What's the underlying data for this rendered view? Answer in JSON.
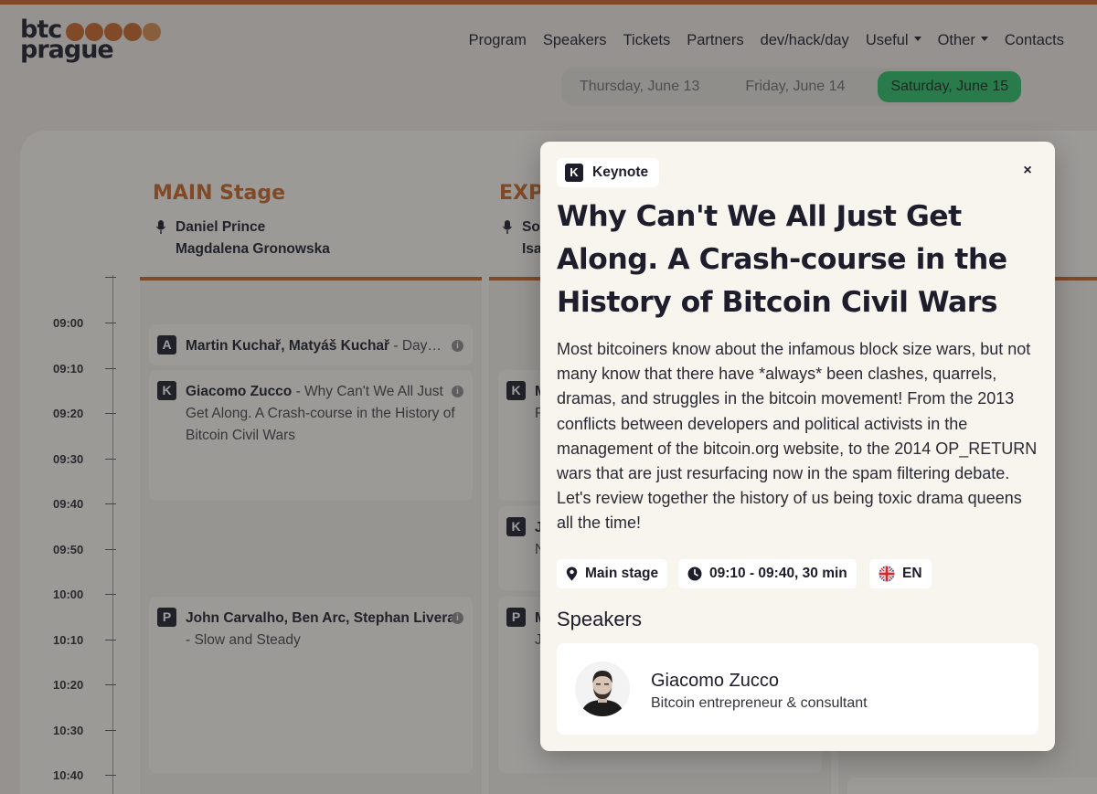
{
  "header": {
    "logo_top": "btc",
    "logo_bottom": "prague",
    "logo_dot_colors": [
      "#c8672a",
      "#c8672a",
      "#c8672a",
      "#c8672a",
      "#d98a4f"
    ],
    "nav": [
      {
        "label": "Program",
        "dropdown": false
      },
      {
        "label": "Speakers",
        "dropdown": false
      },
      {
        "label": "Tickets",
        "dropdown": false
      },
      {
        "label": "Partners",
        "dropdown": false
      },
      {
        "label": "dev/hack/day",
        "dropdown": false
      },
      {
        "label": "Useful",
        "dropdown": true
      },
      {
        "label": "Other",
        "dropdown": true
      },
      {
        "label": "Contacts",
        "dropdown": false
      }
    ]
  },
  "days": [
    {
      "label": "Thursday, June 13",
      "active": false
    },
    {
      "label": "Friday, June 14",
      "active": false
    },
    {
      "label": "Saturday, June 15",
      "active": true
    }
  ],
  "schedule": {
    "stages": [
      {
        "title": "MAIN Stage",
        "mcs": [
          "Daniel Prince",
          "Magdalena Gronowska"
        ]
      },
      {
        "title": "EXPO",
        "mcs": [
          "So",
          "Isa"
        ]
      }
    ],
    "times": [
      "09:00",
      "09:10",
      "09:20",
      "09:30",
      "09:40",
      "09:50",
      "10:00",
      "10:10",
      "10:20",
      "10:30",
      "10:40"
    ],
    "events": [
      {
        "badge": "A",
        "speakers": "Martin Kuchař, Matyáš Kuchař",
        "title": " - Day…"
      },
      {
        "badge": "K",
        "speakers": "Giacomo Zucco",
        "title": " - Why Can't We All Just Get Along. A Crash-course in the History of Bitcoin Civil Wars"
      },
      {
        "badge": "P",
        "speakers": "John Carvalho, Ben Arc, Stephan Livera",
        "title": " - Slow and Steady"
      },
      {
        "badge": "K",
        "speakers": "M",
        "title": "R"
      },
      {
        "badge": "K",
        "speakers": "J",
        "title": "N"
      },
      {
        "badge": "P",
        "speakers": "M",
        "title": "J Y"
      }
    ]
  },
  "modal": {
    "type_badge": "K",
    "type_label": "Keynote",
    "close_glyph": "×",
    "title": "Why Can't We All Just Get Along. A Crash-course in the History of Bitcoin Civil Wars",
    "description": "Most bitcoiners know about the infamous block size wars, but not many know that there have *always* been clashes, quarrels, dramas, and struggles in the bitcoin movement! From the 2013 conflicts between developers and political activists in the management of the bitcoin.org website, to the 2014 OP_RETURN wars that are just resurfacing now in the spam filtering debate. Let's review together the history of us being toxic drama queens all the time!",
    "location": "Main stage",
    "time": "09:10 - 09:40, 30 min",
    "language": "EN",
    "speakers_heading": "Speakers",
    "speaker": {
      "name": "Giacomo Zucco",
      "role": "Bitcoin entrepreneur & consultant"
    }
  },
  "colors": {
    "accent": "#c8672a",
    "active_day": "#2dbf6a",
    "dark": "#1d1d2b"
  }
}
